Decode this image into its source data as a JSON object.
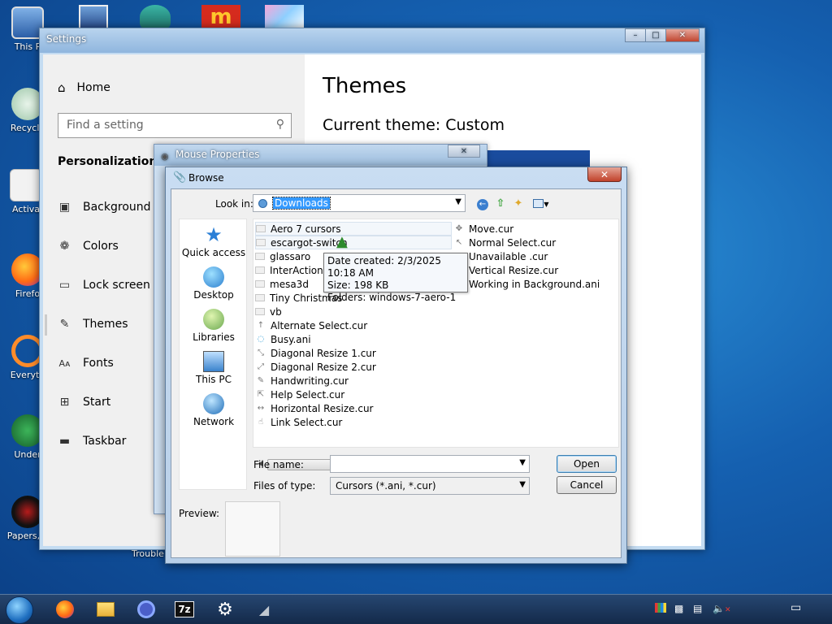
{
  "desktop": {
    "icons": [
      {
        "label": "This P",
        "color": "#3a76c4"
      },
      {
        "label": "Recycle",
        "color": "#7fb58f"
      },
      {
        "label": "Activa",
        "color": "#e8e8e8"
      },
      {
        "label": "Firefo",
        "color": "#ff7a1a"
      },
      {
        "label": "Everyth",
        "color": "#ff8c2a"
      },
      {
        "label": "Under",
        "color": "#2f8a4a"
      },
      {
        "label": "Papers, P",
        "color": "#222222"
      }
    ],
    "top_icons": [
      {
        "name": "app-icon-1",
        "color": "#2b4f8f"
      },
      {
        "name": "app-icon-2",
        "color": "#d0b0c8"
      },
      {
        "name": "app-icon-3",
        "color": "#3ab5a5"
      },
      {
        "name": "mcdonalds-icon",
        "color": "#d52b1e"
      },
      {
        "name": "app-icon-5",
        "color": "#e070b0"
      }
    ],
    "partial_label": "Trouble"
  },
  "settings": {
    "title": "Settings",
    "home_label": "Home",
    "search_placeholder": "Find a setting",
    "section_label": "Personalization",
    "nav_items": [
      {
        "label": "Background",
        "icon": "background-icon",
        "glyph": "▣"
      },
      {
        "label": "Colors",
        "icon": "palette-icon",
        "glyph": "❁"
      },
      {
        "label": "Lock screen",
        "icon": "lock-screen-icon",
        "glyph": "▭"
      },
      {
        "label": "Themes",
        "icon": "themes-icon",
        "glyph": "✎"
      },
      {
        "label": "Fonts",
        "icon": "fonts-icon",
        "glyph": "Aᴀ"
      },
      {
        "label": "Start",
        "icon": "start-icon",
        "glyph": "⊞"
      },
      {
        "label": "Taskbar",
        "icon": "taskbar-icon",
        "glyph": "▬"
      }
    ],
    "page_title": "Themes",
    "current_theme": "Current theme: Custom"
  },
  "mouse_properties": {
    "title": "Mouse Properties",
    "close": "✕"
  },
  "browse": {
    "title": "Browse",
    "close": "✕",
    "look_in_label": "Look in:",
    "look_in_value": "Downloads",
    "places": [
      "Quick access",
      "Desktop",
      "Libraries",
      "This PC",
      "Network"
    ],
    "files_col1": [
      {
        "name": "Aero 7 cursors",
        "type": "folder"
      },
      {
        "name": "escargot-switch",
        "type": "folder"
      },
      {
        "name": "glassaro",
        "type": "folder"
      },
      {
        "name": "InterAction S",
        "type": "folder"
      },
      {
        "name": "mesa3d",
        "type": "folder"
      },
      {
        "name": "Tiny Christmas",
        "type": "folder"
      },
      {
        "name": "vb",
        "type": "folder"
      },
      {
        "name": "Alternate Select.cur",
        "type": "cursor",
        "glyph": "↑"
      },
      {
        "name": "Busy.ani",
        "type": "cursor",
        "glyph": "◌"
      },
      {
        "name": "Diagonal Resize 1.cur",
        "type": "cursor",
        "glyph": "⤡"
      },
      {
        "name": "Diagonal Resize 2.cur",
        "type": "cursor",
        "glyph": "⤢"
      },
      {
        "name": "Handwriting.cur",
        "type": "cursor",
        "glyph": "✎"
      },
      {
        "name": "Help Select.cur",
        "type": "cursor",
        "glyph": "⇱"
      },
      {
        "name": "Horizontal Resize.cur",
        "type": "cursor",
        "glyph": "↔"
      },
      {
        "name": "Link Select.cur",
        "type": "cursor",
        "glyph": "☝"
      }
    ],
    "files_col2": [
      {
        "name": "Move.cur",
        "glyph": "✥"
      },
      {
        "name": "Normal Select.cur",
        "glyph": "↖"
      },
      {
        "name": "Unavailable .cur",
        "glyph": ""
      },
      {
        "name": "Vertical Resize.cur",
        "glyph": ""
      },
      {
        "name": "Working in Background.ani",
        "glyph": ""
      }
    ],
    "tooltip": {
      "date": "Date created: 2/3/2025 10:18 AM",
      "size": "Size: 198 KB",
      "folders": "Folders: windows-7-aero-1"
    },
    "file_name_label": "File name:",
    "file_name_value": "",
    "files_of_type_label": "Files of type:",
    "files_of_type_value": "Cursors (*.ani, *.cur)",
    "open_label": "Open",
    "cancel_label": "Cancel",
    "preview_label": "Preview:"
  },
  "taskbar": {
    "apps": [
      {
        "name": "firefox-taskbar-icon",
        "glyph": "●",
        "color": "#ff7a1a"
      },
      {
        "name": "file-explorer-taskbar-icon",
        "glyph": "▤",
        "color": "#f5c542"
      },
      {
        "name": "app-taskbar-icon",
        "glyph": "◎",
        "color": "#8aa8ff"
      },
      {
        "name": "7zip-taskbar-icon",
        "glyph": "7z",
        "color": "#ffffff"
      },
      {
        "name": "settings-taskbar-icon",
        "glyph": "⚙",
        "color": "#ffffff"
      },
      {
        "name": "mouse-taskbar-icon",
        "glyph": "◢",
        "color": "#c0c8d0"
      }
    ]
  }
}
